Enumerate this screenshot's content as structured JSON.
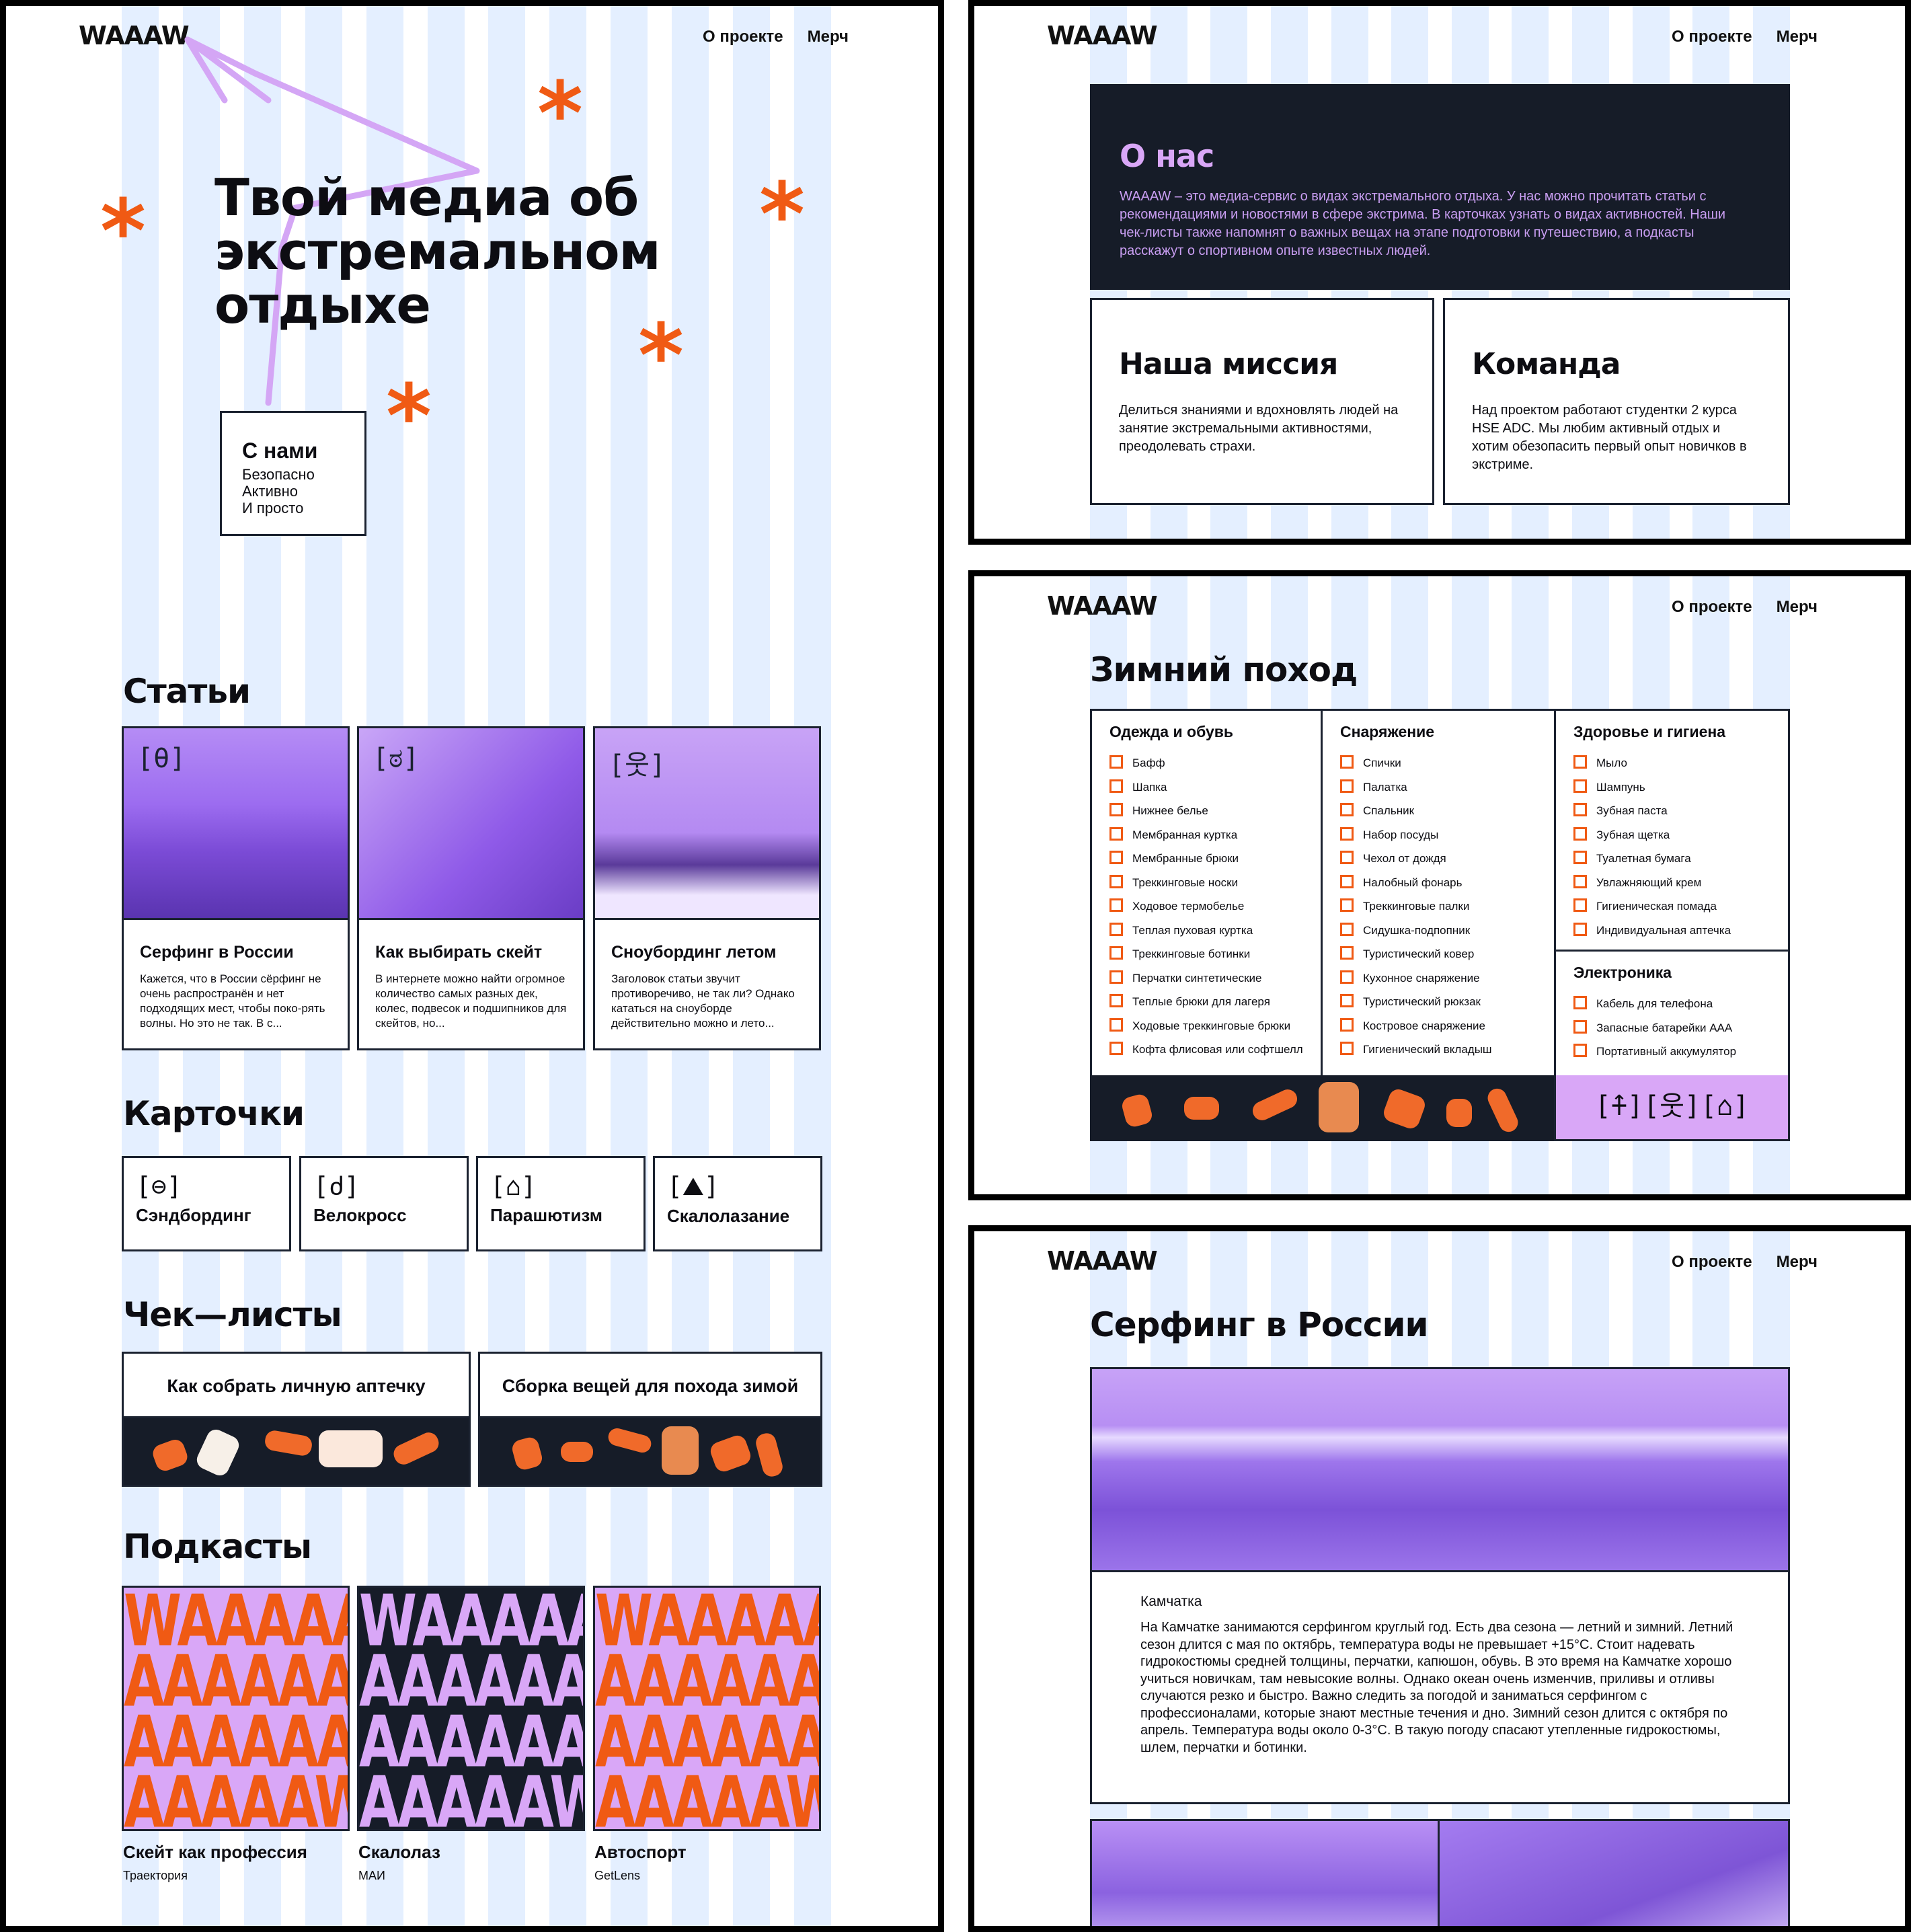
{
  "logo": "WAAAW",
  "nav": {
    "about": "О проекте",
    "merch": "Мерч"
  },
  "hero": {
    "title_lines": [
      "Твой медиа об",
      "экстремальном",
      "отдыхе"
    ],
    "badge_title": "С нами",
    "badge_lines": [
      "Безопасно",
      "Активно",
      "И просто"
    ]
  },
  "articles": {
    "title": "Статьи",
    "items": [
      {
        "icon": "[θ]",
        "title": "Серфинг в России",
        "text": "Кажется, что в России сёрфинг не очень распространён и нет подходящих мест, чтобы поко-рять волны. Но это не так. В с..."
      },
      {
        "icon": "[ಠ]",
        "title": "Как выбирать скейт",
        "text": "В интернете можно найти огромное количество самых разных дек, колес, подвесок и подшипников для скейтов, но..."
      },
      {
        "icon": "[웃]",
        "title": "Сноубординг летом",
        "text": "Заголовок статьи звучит противоречиво, не так ли? Однако кататься на сноуборде действительно можно и лето..."
      }
    ]
  },
  "cards": {
    "title": "Карточки",
    "items": [
      {
        "icon": "[⊖]",
        "label": "Сэндбординг"
      },
      {
        "icon": "[ძ]",
        "label": "Велокросс"
      },
      {
        "icon": "[⌂]",
        "label": "Парашютизм"
      },
      {
        "icon": "[⛰]",
        "label": "Скалолазание"
      }
    ]
  },
  "checklists": {
    "title": "Чек—листы",
    "items": [
      {
        "label": "Как собрать личную аптечку"
      },
      {
        "label": "Сборка вещей для похода зимой"
      }
    ]
  },
  "podcasts": {
    "title": "Подкасты",
    "cover_lines": [
      "WAAAAA",
      "AAAAAAA",
      "AAAAAA",
      "AAAAAW"
    ],
    "items": [
      {
        "title": "Скейт как профессия",
        "author": "Траектория"
      },
      {
        "title": "Скалолаз",
        "author": "МАИ"
      },
      {
        "title": "Автоспорт",
        "author": "GetLens"
      }
    ]
  },
  "about_page": {
    "title": "О нас",
    "text": "WAAAW – это медиа-сервис о видах экстремального отдыха. У нас можно прочитать статьи с рекомендациями и новостями в сфере экстрима. В карточках узнать о видах активностей. Наши чек-листы также напомнят о важных вещах на этапе подготовки к путешествию, а подкасты расскажут о спортивном опыте известных людей.",
    "mission_title": "Наша миссия",
    "mission_text": "Делиться знаниями и вдохновлять людей на занятие экстремальными активностями, преодолевать страхи.",
    "team_title": "Команда",
    "team_text": "Над проектом работают студентки 2 курса HSE ADC. Мы любим активный отдых и хотим обезопасить первый опыт новичков в экстриме."
  },
  "winter_page": {
    "title": "Зимний поход",
    "columns": [
      {
        "title": "Одежда и обувь",
        "items": [
          "Бафф",
          "Шапка",
          "Нижнее белье",
          "Мембранная куртка",
          "Мембранные брюки",
          "Треккинговые носки",
          "Ходовое термобелье",
          "Теплая пуховая куртка",
          "Треккинговые ботинки",
          "Перчатки синтетические",
          "Теплые брюки для лагеря",
          "Ходовые треккинговые брюки",
          "Кофта флисовая или софтшелл"
        ]
      },
      {
        "title": "Снаряжение",
        "items": [
          "Спички",
          "Палатка",
          "Спальник",
          "Набор посуды",
          "Чехол от дождя",
          "Налобный фонарь",
          "Треккинговые палки",
          "Сидушка-подпопник",
          "Туристический ковер",
          "Кухонное снаряжение",
          "Туристический рюкзак",
          "Костровое снаряжение",
          "Гигиенический вкладыш"
        ]
      },
      {
        "title": "Здоровье и гигиена",
        "items": [
          "Мыло",
          "Шампунь",
          "Зубная паста",
          "Зубная щетка",
          "Туалетная бумага",
          "Увлажняющий крем",
          "Гигиеническая помада",
          "Индивидуальная аптечка"
        ]
      },
      {
        "title": "Электроника",
        "items": [
          "Кабель для телефона",
          "Запасные батарейки AAA",
          "Портативный аккумулятор"
        ]
      }
    ],
    "icons": "[⍏][웃][⌂]"
  },
  "surf_page": {
    "title": "Серфинг в России",
    "subtitle": "Камчатка",
    "text": "На Камчатке занимаются серфингом круглый год. Есть два сезона — летний и зимний. Летний сезон длится с мая по октябрь, температура воды не превышает +15°C. Стоит надевать гидрокостюмы средней толщины, перчатки, капюшон, обувь. В это время на Камчатке хорошо учиться новичкам, там невысокие волны. Однако океан очень изменчив, приливы и отливы случаются резко и быстро. Важно следить за погодой и заниматься серфингом с профессионалами, которые знают местные течения и дно. Зимний сезон длится с октября по апрель. Температура воды около 0-3°C. В такую погоду спасают утепленные гидрокостюмы, шлем, перчатки и ботинки."
  },
  "colors": {
    "accent": "#f05a14",
    "lilac": "#d9a7f7",
    "dark": "#161c28",
    "stripe": "#e4efff"
  }
}
